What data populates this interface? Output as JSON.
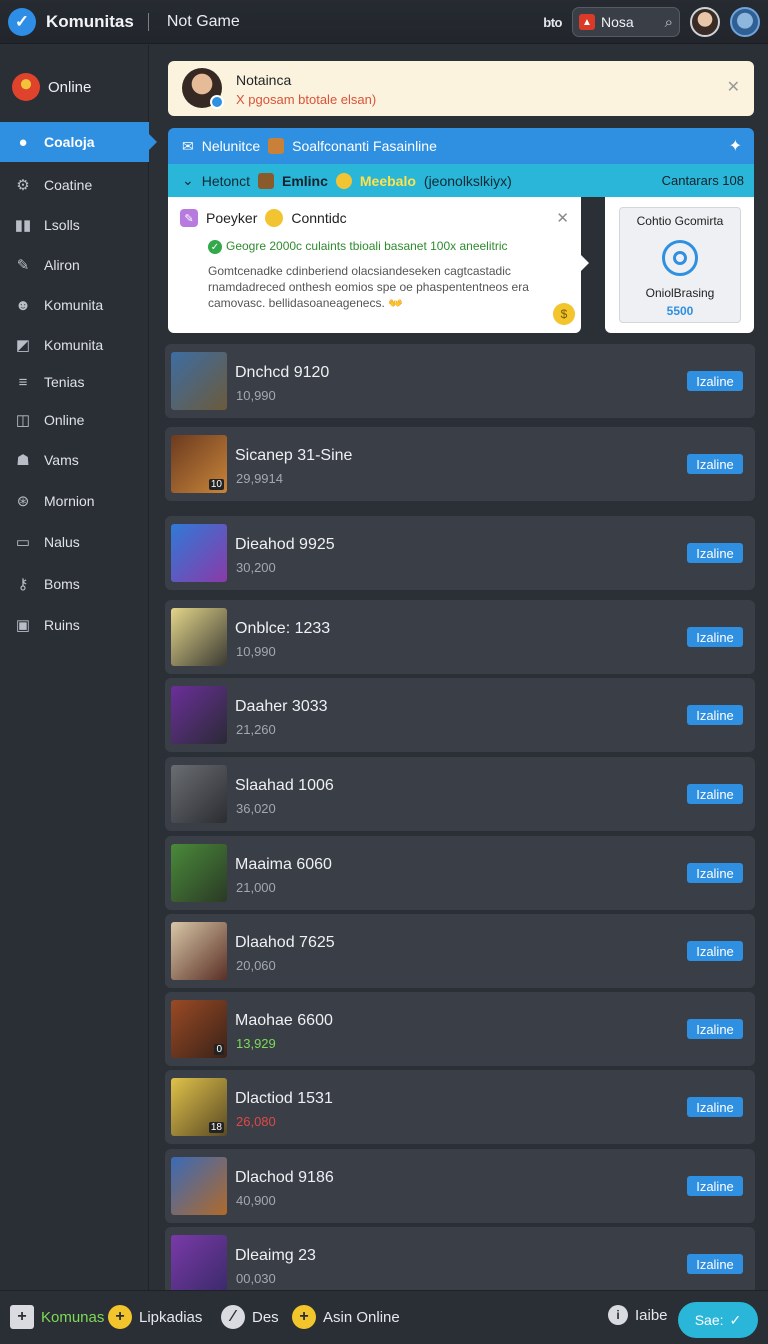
{
  "header": {
    "brand": "Komunitas",
    "subtitle": "Not Game",
    "bto": "bto",
    "search_label": "Nosa"
  },
  "sidebar": {
    "online": "Online",
    "items": [
      {
        "label": "Coaloja",
        "icon": "user-icon",
        "active": true
      },
      {
        "label": "Coatine",
        "icon": "gear-icon"
      },
      {
        "label": "Lsolls",
        "icon": "bars-icon"
      },
      {
        "label": "Aliron",
        "icon": "pen-icon"
      },
      {
        "label": "Komunita",
        "icon": "people-icon"
      },
      {
        "label": "Komunita",
        "icon": "chart-icon"
      },
      {
        "label": "Tenias",
        "icon": "menu-icon"
      },
      {
        "label": "Online",
        "icon": "columns-icon"
      },
      {
        "label": "Vams",
        "icon": "bell-icon"
      },
      {
        "label": "Mornion",
        "icon": "gamepad-icon"
      },
      {
        "label": "Nalus",
        "icon": "monitor-icon"
      },
      {
        "label": "Boms",
        "icon": "key-icon"
      },
      {
        "label": "Ruins",
        "icon": "image-icon"
      }
    ]
  },
  "notification": {
    "title": "Notainca",
    "text": "Х pgosam btotale elsan)"
  },
  "banner1": {
    "text1": "Nelunitce",
    "text2": "Soalfconanti Fasainline"
  },
  "banner2": {
    "text1": "Hetonct",
    "bold": "Emlinc",
    "highlight": "Meebalo",
    "text2": "(jeonolkslkiyx)",
    "right": "Cantarars 108"
  },
  "popup": {
    "title1": "Poeyker",
    "title2": "Conntidc",
    "ok": "Geogre 2000c culaints tbioali basanet 100x aneelitric",
    "body": "Gomtcenadke cdinberiend olacsiandeseken cagtcastadic rnamdadreced onthesh eomios spe oe phaspententneos era camovasc. bellidasoaneagenecs. 👐"
  },
  "sidecard": {
    "title": "Cohtio Gcomirta",
    "name": "OniolBrasing",
    "value": "5500"
  },
  "games": [
    {
      "name": "Dnchcd 9120",
      "number": "10,990",
      "color": "grey"
    },
    {
      "name": "Sicanep 31-Sine",
      "number": "29,9914",
      "color": "grey"
    },
    {
      "name": "Dieahod 9925",
      "number": "30,200",
      "color": "grey"
    },
    {
      "name": "Onblce: 1233",
      "number": "10,990",
      "color": "grey"
    },
    {
      "name": "Daaher 3033",
      "number": "21,260",
      "color": "grey"
    },
    {
      "name": "Slaahad 1006",
      "number": "36,020",
      "color": "grey"
    },
    {
      "name": "Maaima 6060",
      "number": "21,000",
      "color": "grey"
    },
    {
      "name": "Dlaahod 7625",
      "number": "20,060",
      "color": "grey"
    },
    {
      "name": "Maohae 6600",
      "number": "13,929",
      "color": "green"
    },
    {
      "name": "Dlactiod 1531",
      "number": "26,080",
      "color": "red"
    },
    {
      "name": "Dlachod 9186",
      "number": "40,900",
      "color": "grey"
    },
    {
      "name": "Dleaimg 23",
      "number": "00,030",
      "color": "grey"
    }
  ],
  "game_button": "Izaline",
  "bottombar": {
    "item1": "Komunas",
    "item2": "Lipkadias",
    "item3": "Des",
    "item4": "Asin Online",
    "item5": "Iaibe",
    "save": "Sae:"
  }
}
